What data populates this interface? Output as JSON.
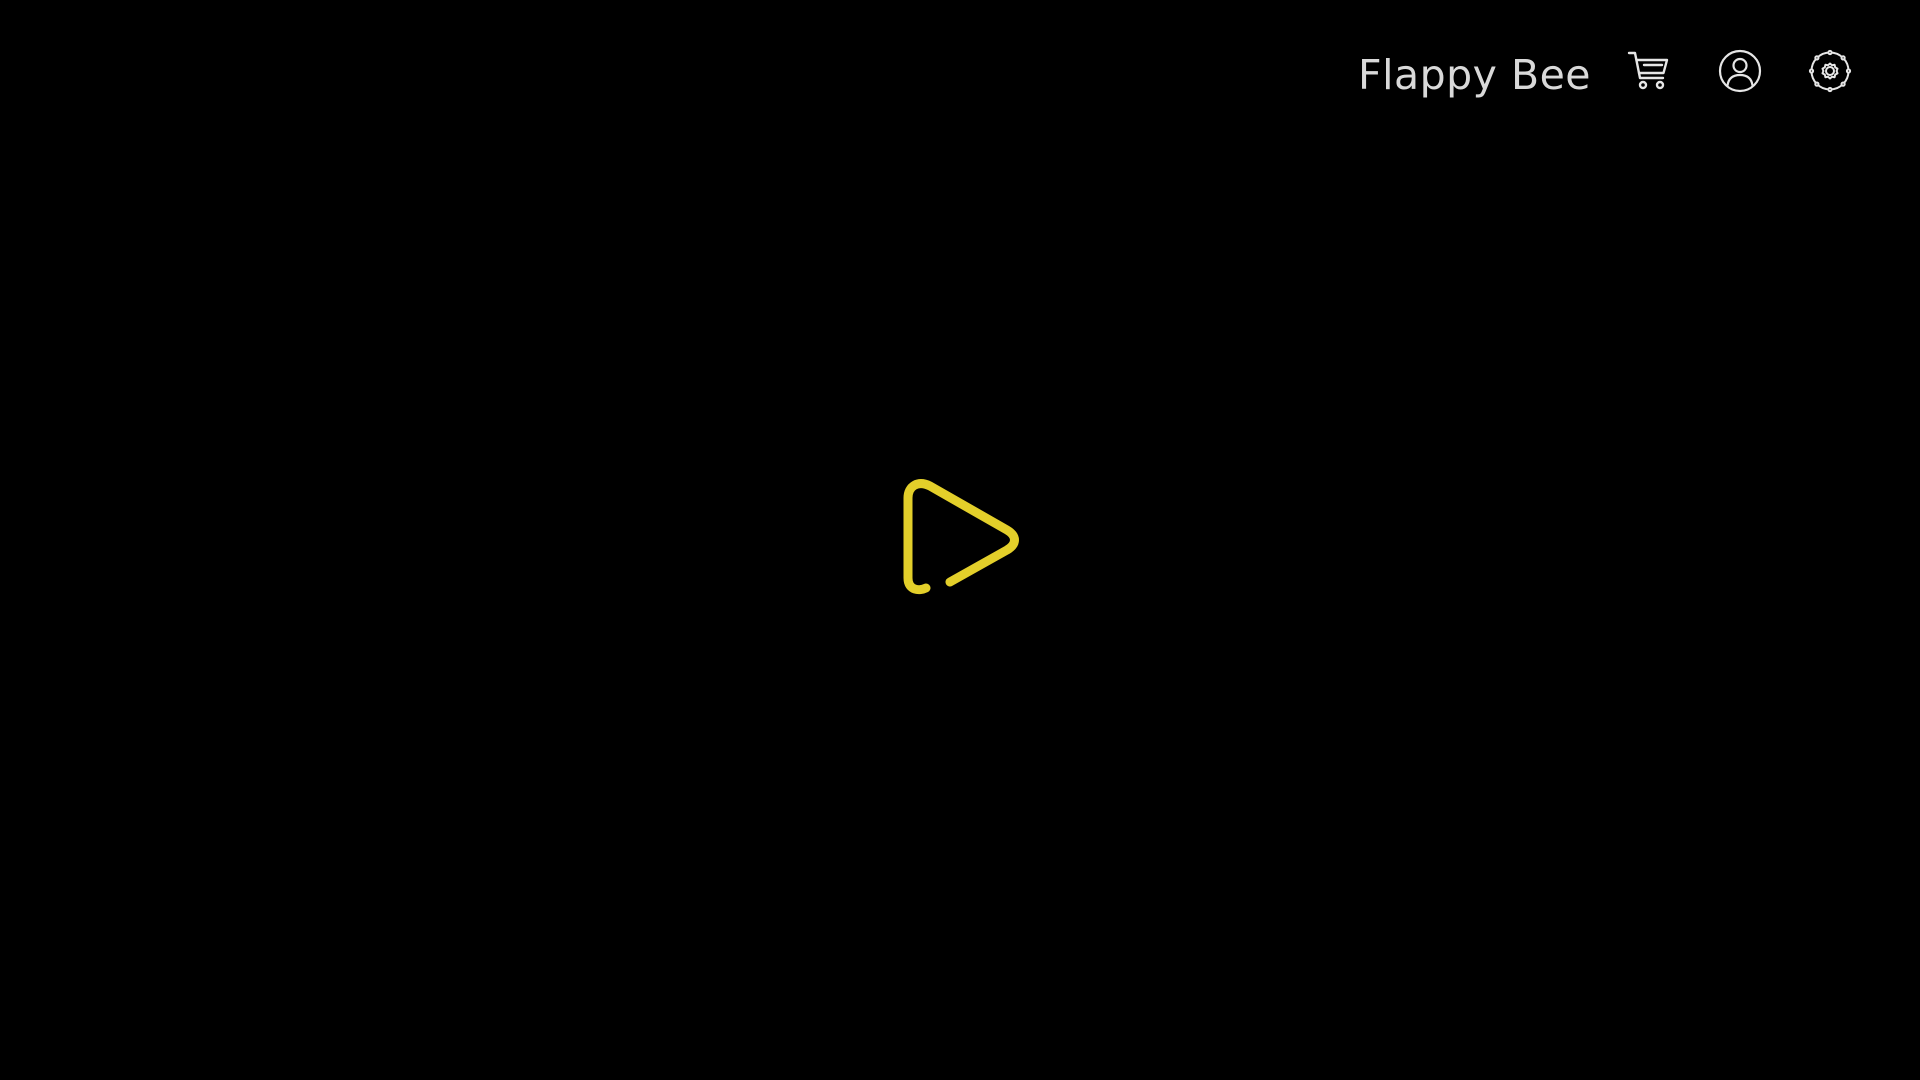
{
  "header": {
    "title": "Flappy Bee",
    "icons": [
      "cart-icon",
      "account-icon",
      "settings-icon"
    ]
  },
  "play_button": {
    "icon": "play-icon"
  },
  "colors": {
    "background": "#000000",
    "title_text": "#d9d9d9",
    "icon_stroke": "#e6e6e6",
    "play_accent": "#e3cf2a"
  }
}
